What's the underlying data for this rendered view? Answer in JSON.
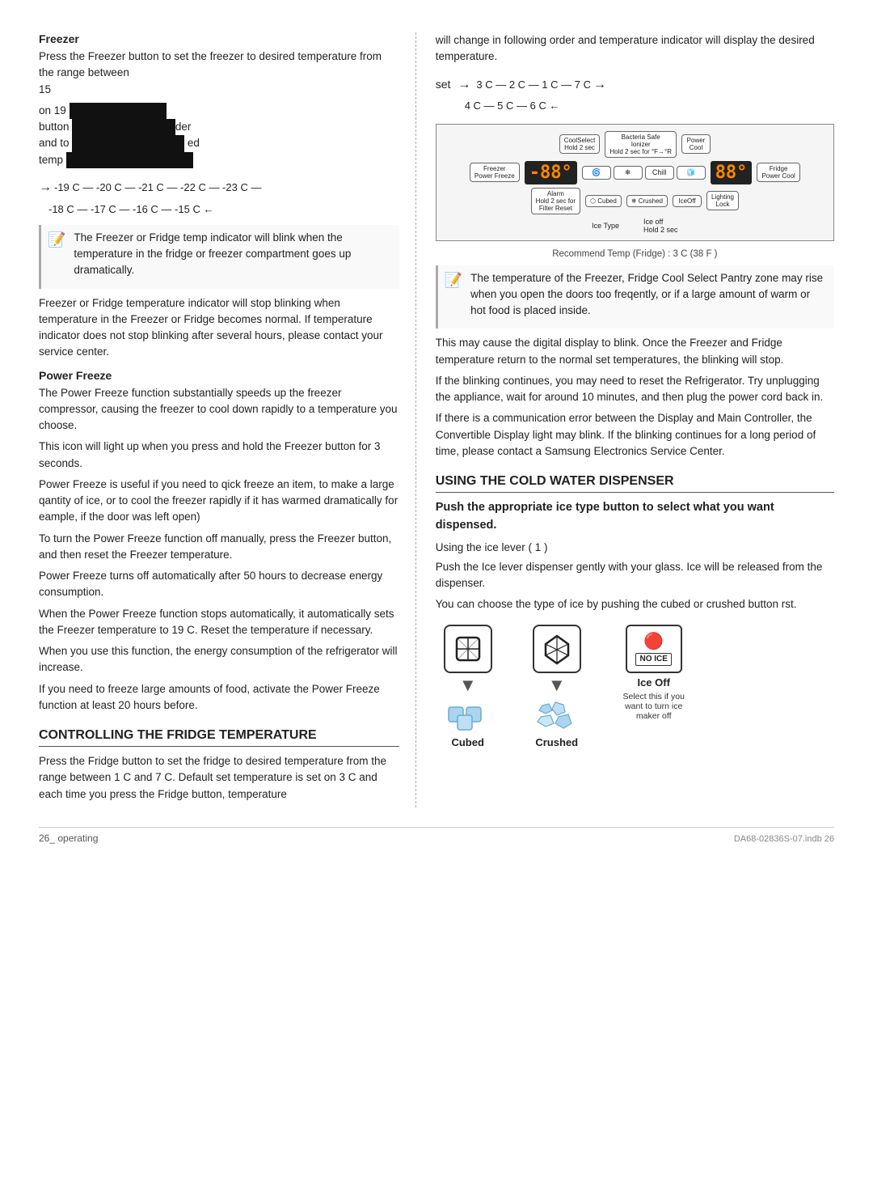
{
  "page": {
    "footer_operating": "26_ operating",
    "footer_doc": "DA68-02836S-07.indb  26"
  },
  "left_col": {
    "freezer_heading": "Freezer",
    "freezer_p1": "Press the Freezer button to set the freezer to desired temperature from the range between",
    "freezer_p1b": "15",
    "freezer_on": "on 19",
    "freezer_button": "button",
    "freezer_and": "and to",
    "freezer_ed": "ed",
    "freezer_temp": "temp",
    "temp_cycle_top": "-19 C — -20 C — -21 C — -22 C — -23 C —",
    "temp_cycle_bot": "-18 C — -17 C — -16 C — -15 C ←",
    "note_freezer": "The Freezer or Fridge temp indicator will blink when the temperature in the fridge or freezer compartment goes up dramatically.",
    "indicator_stop_p": "Freezer or Fridge temperature indicator will stop blinking when temperature in the Freezer or Fridge becomes normal. If temperature indicator does not stop blinking after several hours, please contact your service center.",
    "power_freeze_heading": "Power Freeze",
    "power_freeze_p1": "The Power Freeze function substantially speeds up the freezer compressor, causing the freezer to cool down rapidly to a temperature you choose.",
    "power_freeze_p2": "This icon will light up when you press and hold the Freezer button for 3 seconds.",
    "power_freeze_p3": "Power Freeze is useful if you need to qick freeze an item, to make a large qantity of ice, or to cool the freezer rapidly if it has warmed dramatically for eample, if the door was left open)",
    "power_freeze_p4": "To turn the Power Freeze function off manually, press the Freezer button, and then reset the Freezer temperature.",
    "power_freeze_p5": "Power Freeze turns off automatically after 50 hours to decrease energy consumption.",
    "power_freeze_p6": "When the Power Freeze function stops automatically, it automatically sets the Freezer temperature to 19    C. Reset the temperature if necessary.",
    "power_freeze_p7": "When you use this function, the energy consumption of the refrigerator will increase.",
    "power_freeze_p8": "If you need to freeze large amounts of food, activate the Power Freeze function at least 20 hours before.",
    "controlling_heading": "CONTROLLING THE FRIDGE TEMPERATURE",
    "controlling_p1": "Press the Fridge button to set the fridge to desired temperature from the range between 1    C and 7    C. Default set temperature is set on 3    C and each time you press the Fridge button, temperature"
  },
  "right_col": {
    "intro_p1": "will change in following order and temperature indicator will display the desired temperature.",
    "temp_set_top": "3 C — 2 C — 1 C — 7 C",
    "temp_set_bot": "4 C — 5 C — 6 C ←",
    "rec_temp": "Recommend Temp (Fridge) : 3 C (38 F )",
    "note_rise_p": "The temperature of the Freezer, Fridge Cool Select Pantry zone may rise when you open the doors too freqently, or if a large amount of warm or hot food is placed inside.",
    "blink_p1": "This may cause the digital display to blink. Once the Freezer and Fridge temperature return to the normal set temperatures, the blinking will stop.",
    "blink_p2": "If the blinking continues, you may need to  reset the Refrigerator. Try unplugging the appliance, wait for around 10 minutes, and then plug the power cord back in.",
    "blink_p3": "If there is a communication error between the Display and Main Controller, the Convertible Display light may blink. If the blinking continues for a long period of time, please contact a Samsung Electronics Service Center.",
    "cold_water_heading": "USING THE COLD WATER DISPENSER",
    "subheading": "Push the appropriate ice type button to select what you want dispensed.",
    "using_lever": "Using the ice lever ( 1 )",
    "lever_p1": "Push the Ice lever dispenser gently with your glass. Ice will be released from the dispenser.",
    "lever_p2": "You can choose the type of ice by pushing the cubed or crushed button   rst.",
    "ice_cubed_label": "Cubed",
    "ice_crushed_label": "Crushed",
    "ice_off_label": "Ice Off",
    "ice_no_ice": "NO ICE",
    "ice_off_sub": "Select this if you want to turn ice maker off",
    "panel": {
      "coolselect": "CoolSelect",
      "bacteria_safe": "Bacteria Safe\nIonizer",
      "power_cool": "Power\nCool",
      "freezer": "Freezer\nPower Freeze",
      "temp_l": "-88°",
      "temp_r": "88°",
      "fridge": "Fridge\nPower Cool",
      "alarm": "Alarm\nFilter Reset",
      "cubed": "Cubed",
      "crushed": "Crushed",
      "ice_off": "IceOff",
      "lighting": "Lighting\nLock",
      "ice_type": "Ice Type",
      "ice_off2": "Ice off\nHold 2 sec"
    }
  }
}
